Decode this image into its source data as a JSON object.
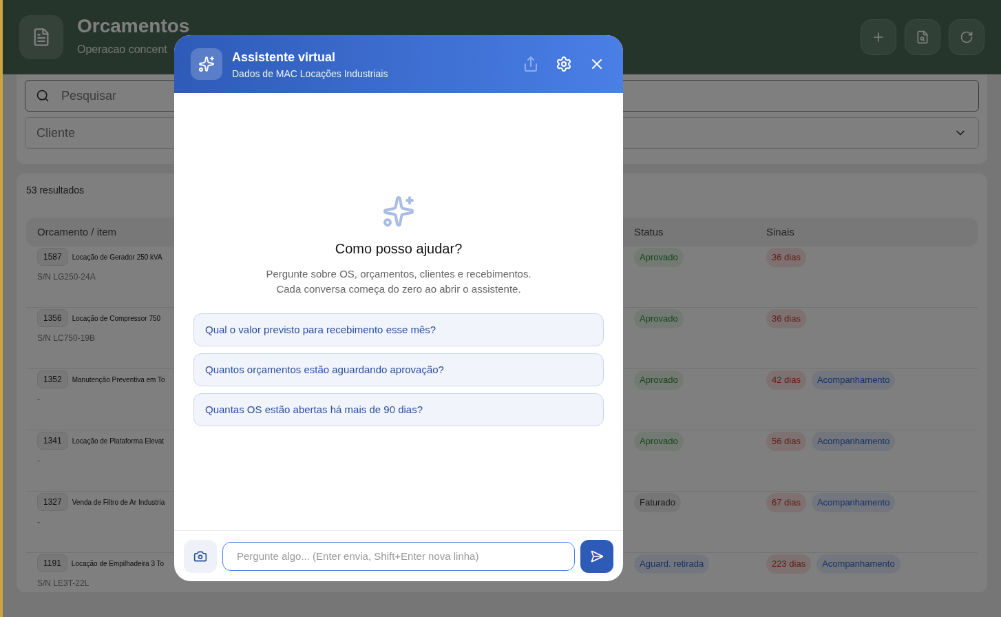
{
  "header": {
    "title": "Orcamentos",
    "subtitle": "Operacao concent",
    "actions": [
      {
        "kind": "add"
      },
      {
        "kind": "preview"
      },
      {
        "kind": "refresh"
      }
    ]
  },
  "filters": {
    "search": {
      "placeholder": "Pesquisar"
    },
    "client": {
      "placeholder": "Cliente"
    }
  },
  "results": {
    "count": "53 resultados",
    "columns": [
      "Orcamento / item",
      "Status",
      "Sinais"
    ],
    "rows": [
      {
        "number": "1587",
        "item": "Locação de Gerador 250 kVA",
        "serial": "S/N LG250-24A",
        "status": {
          "label": "Aprovado",
          "kind": "approved"
        },
        "signals": [
          {
            "label": "36 dias",
            "kind": "days"
          }
        ]
      },
      {
        "number": "1356",
        "item": "Locação de Compressor 750",
        "serial": "S/N LC750-19B",
        "status": {
          "label": "Aprovado",
          "kind": "approved"
        },
        "signals": [
          {
            "label": "36 dias",
            "kind": "days"
          }
        ]
      },
      {
        "number": "1352",
        "item": "Manutenção Preventiva em To",
        "serial": "-",
        "status": {
          "label": "Aprovado",
          "kind": "approved"
        },
        "signals": [
          {
            "label": "42 dias",
            "kind": "days"
          },
          {
            "label": "Acompanhamento",
            "kind": "follow"
          }
        ]
      },
      {
        "number": "1341",
        "item": "Locação de Plataforma Elevat",
        "serial": "-",
        "status": {
          "label": "Aprovado",
          "kind": "approved"
        },
        "signals": [
          {
            "label": "56 dias",
            "kind": "days"
          },
          {
            "label": "Acompanhamento",
            "kind": "follow"
          }
        ]
      },
      {
        "number": "1327",
        "item": "Venda de Filtro de Ar Industria",
        "serial": "-",
        "status": {
          "label": "Faturado",
          "kind": "invoiced"
        },
        "signals": [
          {
            "label": "67 dias",
            "kind": "days"
          },
          {
            "label": "Acompanhamento",
            "kind": "follow"
          }
        ]
      },
      {
        "number": "1191",
        "item": "Locação de Empilhadeira 3 To",
        "serial": "S/N LE3T-22L",
        "status": {
          "label": "Aguard. retirada",
          "kind": "pickup"
        },
        "signals": [
          {
            "label": "223 dias",
            "kind": "days"
          },
          {
            "label": "Acompanhamento",
            "kind": "follow"
          }
        ]
      }
    ]
  },
  "assistant": {
    "title": "Assistente virtual",
    "subtitle": "Dados de MAC Locações Industriais",
    "actions": [
      {
        "kind": "share",
        "disabled": true
      },
      {
        "kind": "settings",
        "disabled": false
      },
      {
        "kind": "close",
        "disabled": false
      }
    ],
    "heading": "Como posso ajudar?",
    "description": [
      "Pergunte sobre OS, orçamentos, clientes e recebimentos.",
      "Cada conversa começa do zero ao abrir o assistente."
    ],
    "suggestions": [
      "Qual o valor previsto para recebimento esse mês?",
      "Quantos orçamentos estão aguardando aprovação?",
      "Quantas OS estão abertas há mais de 90 dias?"
    ],
    "input": {
      "placeholder": "Pergunte algo... (Enter envia, Shift+Enter nova linha)"
    }
  }
}
